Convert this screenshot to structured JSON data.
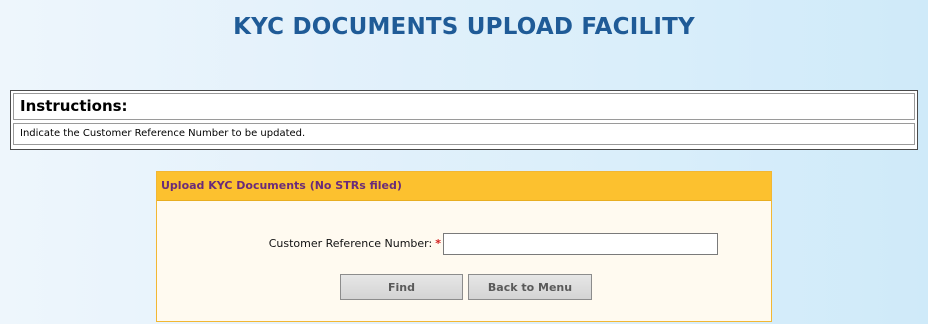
{
  "header": {
    "title": "KYC DOCUMENTS UPLOAD FACILITY"
  },
  "instructions": {
    "heading": "Instructions:",
    "text": "Indicate the Customer Reference Number to be updated."
  },
  "upload_form": {
    "title": "Upload KYC Documents (No STRs filed)",
    "field_label": "Customer Reference Number:",
    "required_marker": "*",
    "field_value": "",
    "field_placeholder": "",
    "find_label": "Find",
    "back_label": "Back to Menu"
  },
  "colors": {
    "title": "#1f5b97",
    "panel_header": "#fcc12f",
    "panel_header_text": "#6a2a7a",
    "required": "#d21c1c"
  }
}
